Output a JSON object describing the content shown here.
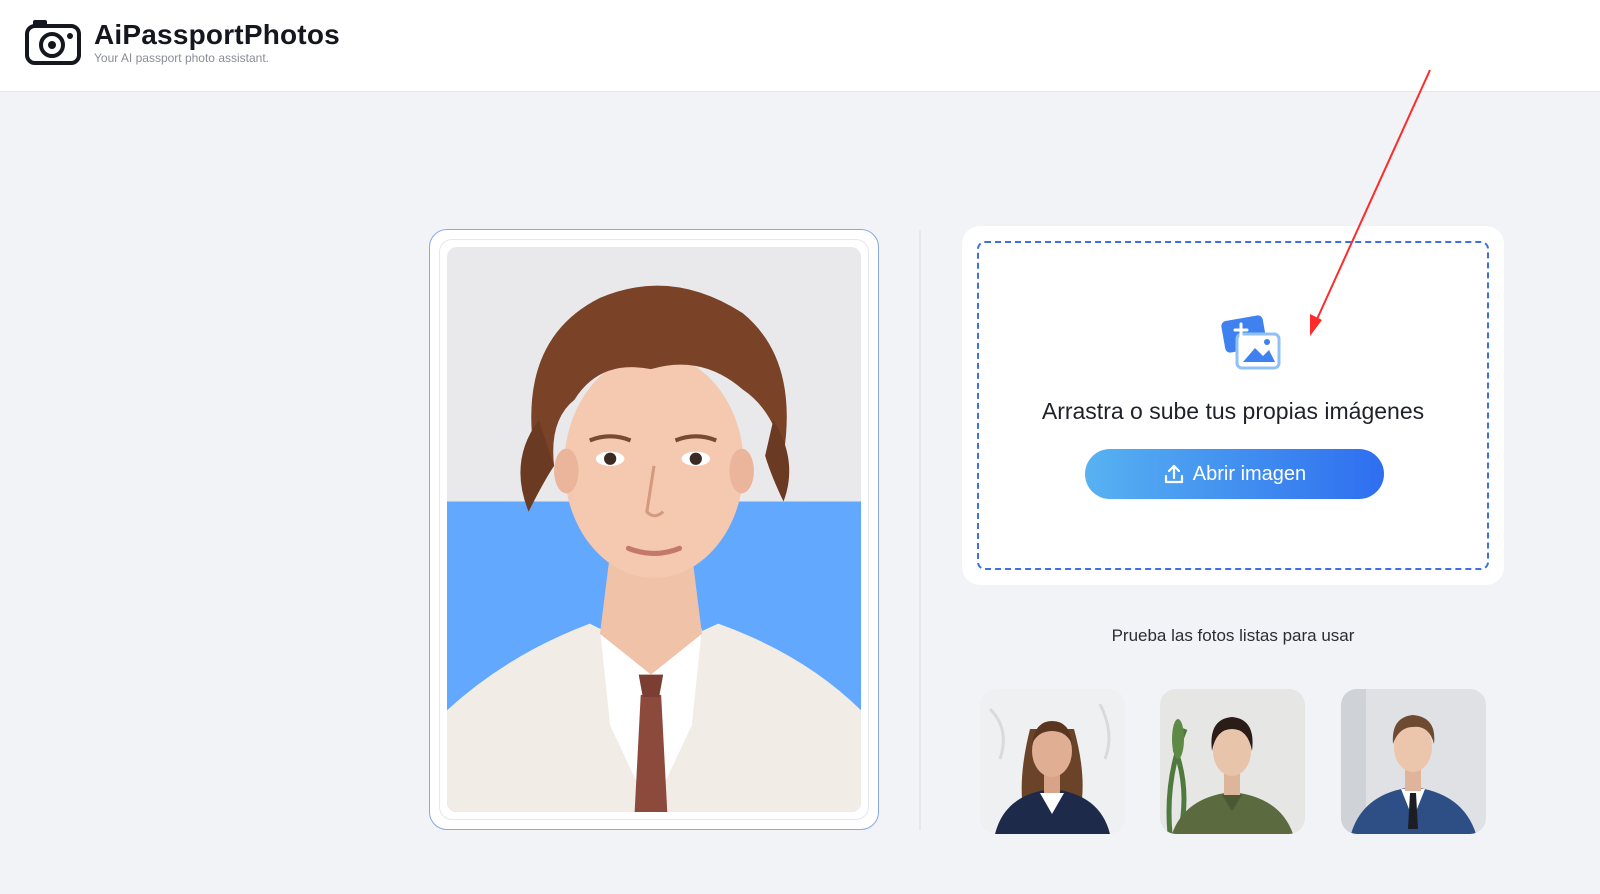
{
  "header": {
    "brand_name": "AiPassportPhotos",
    "tagline": "Your AI passport photo assistant.",
    "logo_icon": "camera-icon"
  },
  "preview": {
    "background_top_color": "#e9e9ec",
    "background_bottom_color": "#63a8ff"
  },
  "upload": {
    "drop_text": "Arrastra o sube tus propias imágenes",
    "button_label": "Abrir imagen",
    "icon": "add-image-icon",
    "button_icon": "upload-icon",
    "accent_color": "#2e6ef0"
  },
  "samples": {
    "title": "Prueba las fotos listas para usar",
    "items": [
      {
        "icon": "sample-woman-blazer"
      },
      {
        "icon": "sample-woman-green-shirt"
      },
      {
        "icon": "sample-man-suit"
      }
    ]
  },
  "annotation": {
    "arrow_color": "#ff2a2a"
  }
}
